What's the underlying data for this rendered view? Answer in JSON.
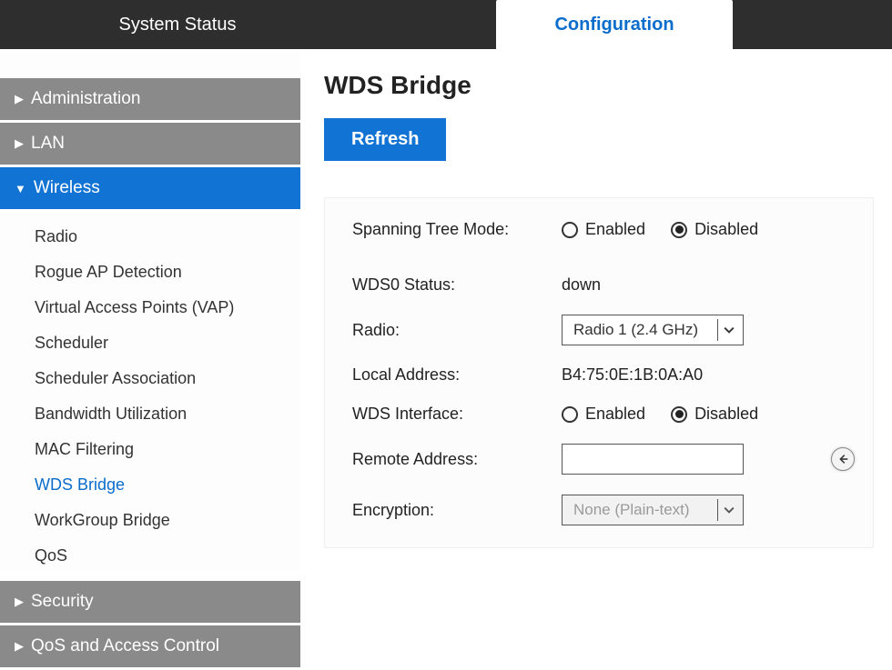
{
  "topbar": {
    "left": "System Status",
    "right": "Configuration"
  },
  "sidebar": {
    "groups": [
      {
        "label": "Administration",
        "expanded": false,
        "active": false
      },
      {
        "label": "LAN",
        "expanded": false,
        "active": false
      },
      {
        "label": "Wireless",
        "expanded": true,
        "active": true
      },
      {
        "label": "Security",
        "expanded": false,
        "active": false
      },
      {
        "label": "QoS and Access Control",
        "expanded": false,
        "active": false
      }
    ],
    "wireless_items": [
      {
        "label": "Radio",
        "active": false
      },
      {
        "label": "Rogue AP Detection",
        "active": false
      },
      {
        "label": "Virtual Access Points (VAP)",
        "active": false
      },
      {
        "label": "Scheduler",
        "active": false
      },
      {
        "label": "Scheduler Association",
        "active": false
      },
      {
        "label": "Bandwidth Utilization",
        "active": false
      },
      {
        "label": "MAC Filtering",
        "active": false
      },
      {
        "label": "WDS Bridge",
        "active": true
      },
      {
        "label": "WorkGroup Bridge",
        "active": false
      },
      {
        "label": "QoS",
        "active": false
      }
    ]
  },
  "page": {
    "title": "WDS Bridge",
    "refresh": "Refresh"
  },
  "form": {
    "spanning_label": "Spanning Tree Mode:",
    "option_enabled": "Enabled",
    "option_disabled": "Disabled",
    "wds0_label": "WDS0 Status:",
    "wds0_value": "down",
    "radio_label": "Radio:",
    "radio_value": "Radio 1 (2.4 GHz)",
    "local_addr_label": "Local Address:",
    "local_addr_value": "B4:75:0E:1B:0A:A0",
    "wds_iface_label": "WDS Interface:",
    "remote_addr_label": "Remote Address:",
    "remote_addr_value": "",
    "encryption_label": "Encryption:",
    "encryption_value": "None (Plain-text)"
  }
}
